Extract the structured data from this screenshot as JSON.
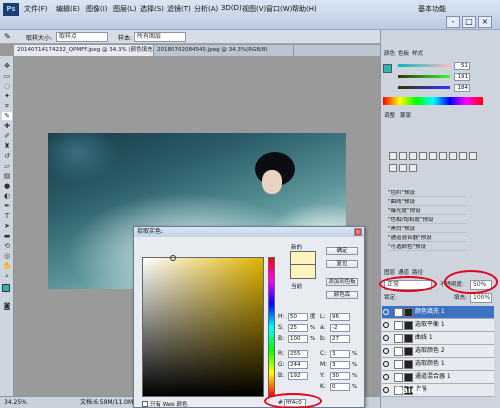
{
  "app": {
    "menu": [
      "文件(F)",
      "编辑(E)",
      "图像(I)",
      "图层(L)",
      "选择(S)",
      "滤镜(T)",
      "分析(A)",
      "3D(D)",
      "视图(V)",
      "窗口(W)",
      "帮助(H)"
    ],
    "workspace": "基本功能",
    "window_controls": [
      "-",
      "□",
      "×"
    ]
  },
  "options": {
    "sample_size_label": "取样大小:",
    "sample_size_value": "取样点",
    "sample_label": "样本:",
    "sample_value": "所有图层"
  },
  "tabs": [
    {
      "label": "20140714174232_QPMFF.jpeg @ 34.3% (颜色填充 1, RGB/8) *",
      "active": true
    },
    {
      "label": "20180702084545.jpeg @ 34.3%(RGB/8)",
      "active": false
    }
  ],
  "status": {
    "zoom": "34.25%",
    "doc": "文档:6.59M/11.0M"
  },
  "panels": {
    "color_tabs": [
      "颜色",
      "色板",
      "样式"
    ],
    "color_values": [
      "51",
      "191",
      "184"
    ],
    "adjust_tabs": [
      "调整",
      "蒙版"
    ],
    "presets": [
      "\"色阶\"预设",
      "\"曲线\"预设",
      "\"曝光度\"预设",
      "\"色相/饱和度\"预设",
      "\"黑白\"预设",
      "\"通道混合器\"预设",
      "\"可选颜色\"预设"
    ],
    "layer_tabs": [
      "图层",
      "通道",
      "路径"
    ],
    "blend_mode": "正常",
    "opacity_label": "不透明度:",
    "opacity": "50%",
    "fill_label": "填充:",
    "fill": "100%",
    "lock_label": "锁定:",
    "layers": [
      {
        "name": "颜色填充 1",
        "selected": true
      },
      {
        "name": "选取平衡 1",
        "selected": false
      },
      {
        "name": "曲线 1",
        "selected": false
      },
      {
        "name": "选取颜色 2",
        "selected": false
      },
      {
        "name": "选取颜色 1",
        "selected": false
      },
      {
        "name": "通道混合器 1",
        "selected": false
      },
      {
        "name": "背景",
        "selected": false
      }
    ]
  },
  "dialog": {
    "title": "拾取实色:",
    "new_label": "新的",
    "current_label": "当前",
    "buttons": {
      "ok": "确定",
      "cancel": "复位",
      "add_swatch": "添加到色板",
      "libraries": "颜色库"
    },
    "hsb": [
      {
        "label": "H:",
        "value": "50",
        "unit": "度"
      },
      {
        "label": "S:",
        "value": "25",
        "unit": "%"
      },
      {
        "label": "B:",
        "value": "100",
        "unit": "%"
      }
    ],
    "rgb": [
      {
        "label": "R:",
        "value": "255"
      },
      {
        "label": "G:",
        "value": "244"
      },
      {
        "label": "B:",
        "value": "192"
      }
    ],
    "lab": [
      {
        "label": "L:",
        "value": "96"
      },
      {
        "label": "a:",
        "value": "-2"
      },
      {
        "label": "b:",
        "value": "27"
      }
    ],
    "cmyk": [
      {
        "label": "C:",
        "value": "3",
        "unit": "%"
      },
      {
        "label": "M:",
        "value": "3",
        "unit": "%"
      },
      {
        "label": "Y:",
        "value": "30",
        "unit": "%"
      },
      {
        "label": "K:",
        "value": "0",
        "unit": "%"
      }
    ],
    "web_only_label": "只有 Web 颜色",
    "hex_label": "#",
    "hex_value": "fff4c0"
  },
  "colors": {
    "picked": "#fff4c0",
    "foreground": "#2bb6b3",
    "highlight": "#e3001b",
    "selection": "#3b73c2"
  },
  "watermark": "Baidu"
}
